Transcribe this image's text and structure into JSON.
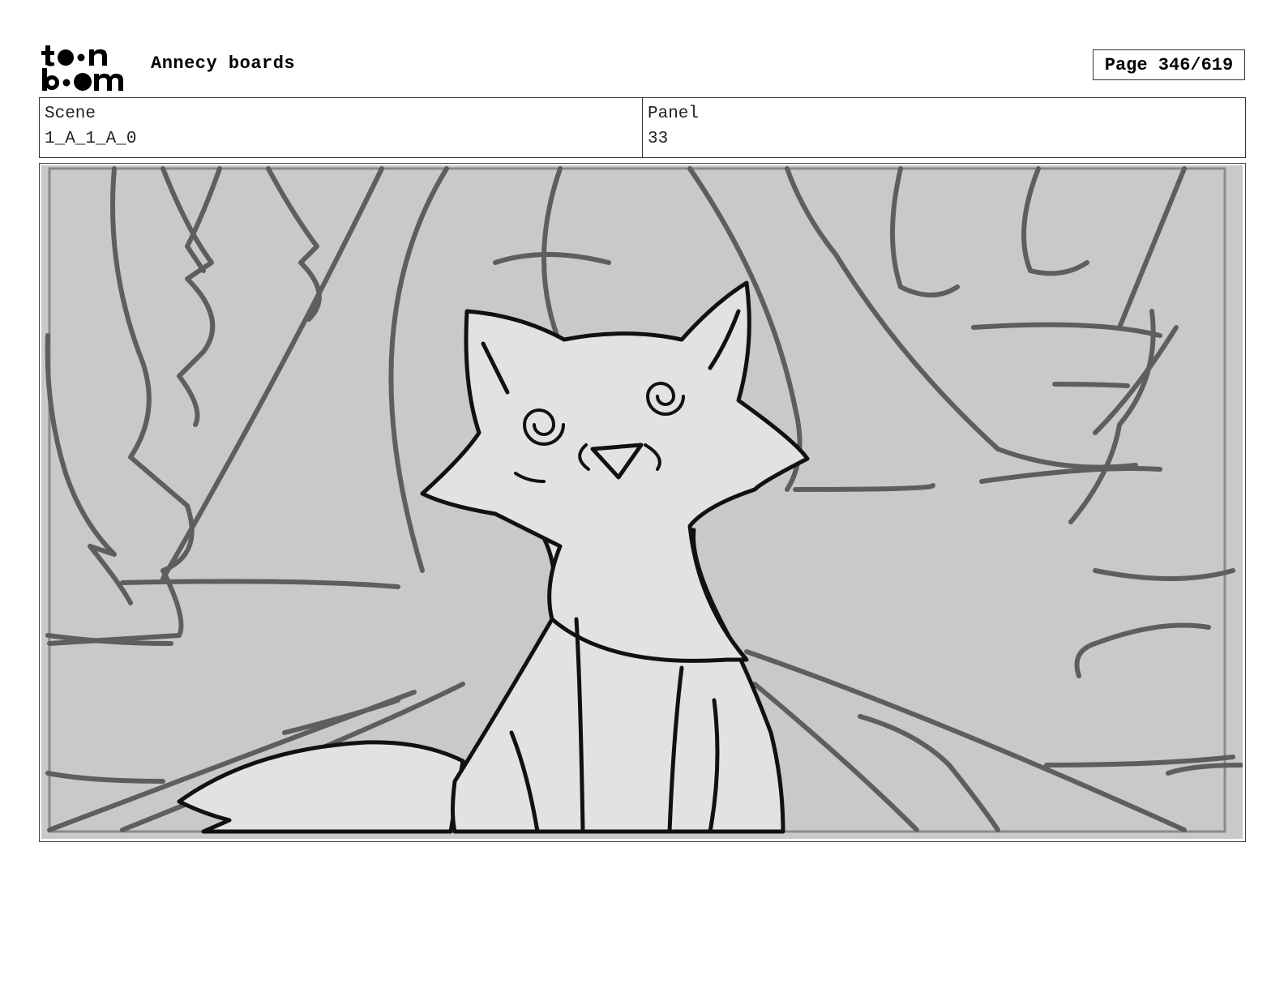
{
  "header": {
    "logo_text": "toon boom",
    "doc_title": "Annecy boards",
    "page": "Page 346/619"
  },
  "info": {
    "scene_label": "Scene",
    "scene_value": "1_A_1_A_0",
    "panel_label": "Panel",
    "panel_value": "33"
  },
  "panel_image": {
    "subject": "fox-sketch",
    "palette": {
      "background": "#c9c9c9",
      "fox_fill": "#e2e2e2",
      "tree_stroke": "#5e5e5e",
      "fox_stroke": "#111111"
    }
  }
}
